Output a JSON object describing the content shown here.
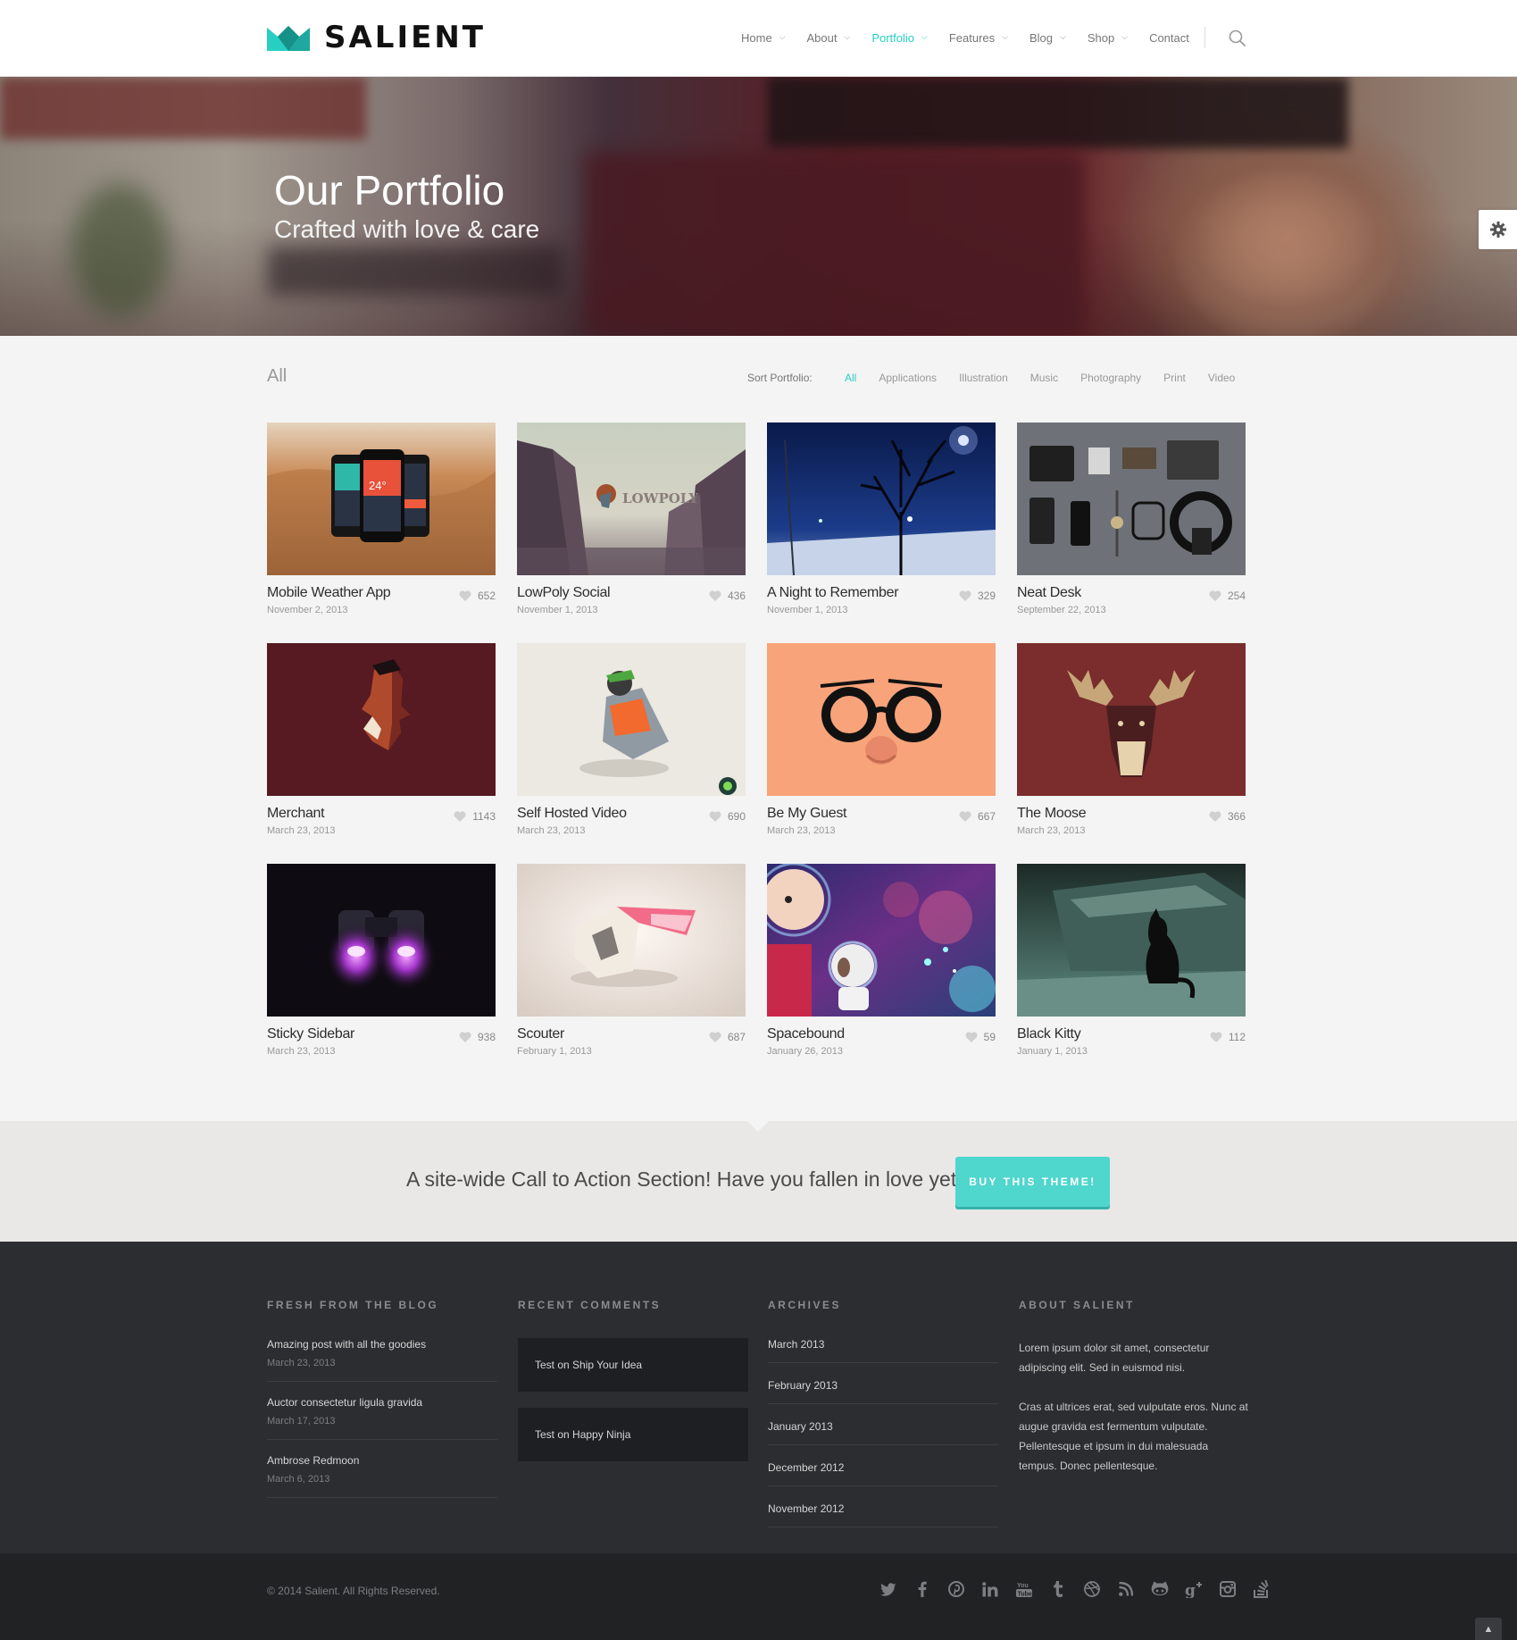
{
  "brand": {
    "name": "SALIENT",
    "accent": "#27cfc3"
  },
  "nav": {
    "items": [
      {
        "label": "Home",
        "has_menu": true
      },
      {
        "label": "About",
        "has_menu": true
      },
      {
        "label": "Portfolio",
        "has_menu": true,
        "active": true
      },
      {
        "label": "Features",
        "has_menu": true
      },
      {
        "label": "Blog",
        "has_menu": true
      },
      {
        "label": "Shop",
        "has_menu": true
      },
      {
        "label": "Contact",
        "has_menu": false
      }
    ],
    "search_icon": "search-icon"
  },
  "hero": {
    "title": "Our Portfolio",
    "subtitle": "Crafted with love & care"
  },
  "filter": {
    "current": "All",
    "sort_label": "Sort Portfolio:",
    "options": [
      "All",
      "Applications",
      "Illustration",
      "Music",
      "Photography",
      "Print",
      "Video"
    ],
    "active": "All"
  },
  "portfolio": [
    {
      "title": "Mobile Weather App",
      "date": "November 2, 2013",
      "likes": "652"
    },
    {
      "title": "LowPoly Social",
      "date": "November 1, 2013",
      "likes": "436"
    },
    {
      "title": "A Night to Remember",
      "date": "November 1, 2013",
      "likes": "329"
    },
    {
      "title": "Neat Desk",
      "date": "September 22, 2013",
      "likes": "254"
    },
    {
      "title": "Merchant",
      "date": "March 23, 2013",
      "likes": "1143"
    },
    {
      "title": "Self Hosted Video",
      "date": "March 23, 2013",
      "likes": "690"
    },
    {
      "title": "Be My Guest",
      "date": "March 23, 2013",
      "likes": "667"
    },
    {
      "title": "The Moose",
      "date": "March 23, 2013",
      "likes": "366"
    },
    {
      "title": "Sticky Sidebar",
      "date": "March 23, 2013",
      "likes": "938"
    },
    {
      "title": "Scouter",
      "date": "February 1, 2013",
      "likes": "687"
    },
    {
      "title": "Spacebound",
      "date": "January 26, 2013",
      "likes": "59"
    },
    {
      "title": "Black Kitty",
      "date": "January 1, 2013",
      "likes": "112"
    }
  ],
  "thumb_text": {
    "lowpoly": "LOWPOLY",
    "weather_temp": "24°"
  },
  "cta": {
    "text": "A site-wide Call to Action Section! Have you fallen in love yet?",
    "button": "BUY THIS THEME!",
    "color": "#4fd6cd"
  },
  "footer": {
    "blog": {
      "heading": "FRESH FROM THE BLOG",
      "items": [
        {
          "title": "Amazing post with all the goodies",
          "date": "March 23, 2013"
        },
        {
          "title": "Auctor consectetur ligula gravida",
          "date": "March 17, 2013"
        },
        {
          "title": "Ambrose Redmoon",
          "date": "March 6, 2013"
        }
      ]
    },
    "comments": {
      "heading": "RECENT COMMENTS",
      "items": [
        "Test on Ship Your Idea",
        "Test on Happy Ninja"
      ]
    },
    "archives": {
      "heading": "ARCHIVES",
      "items": [
        "March 2013",
        "February 2013",
        "January 2013",
        "December 2012",
        "November 2012"
      ]
    },
    "about": {
      "heading": "ABOUT SALIENT",
      "paragraphs": [
        "Lorem ipsum dolor sit amet, consectetur adipiscing elit. Sed in euismod nisi.",
        "Cras at ultrices erat, sed vulputate eros. Nunc at augue gravida est fermentum vulputate. Pellentesque et ipsum in dui malesuada tempus. Donec pellentesque."
      ]
    },
    "copyright": "© 2014 Salient. All Rights Reserved.",
    "social_icons": [
      "twitter-icon",
      "facebook-icon",
      "pinterest-icon",
      "linkedin-icon",
      "youtube-icon",
      "tumblr-icon",
      "dribbble-icon",
      "rss-icon",
      "github-icon",
      "google-plus-icon",
      "instagram-icon",
      "stackexchange-icon"
    ]
  }
}
